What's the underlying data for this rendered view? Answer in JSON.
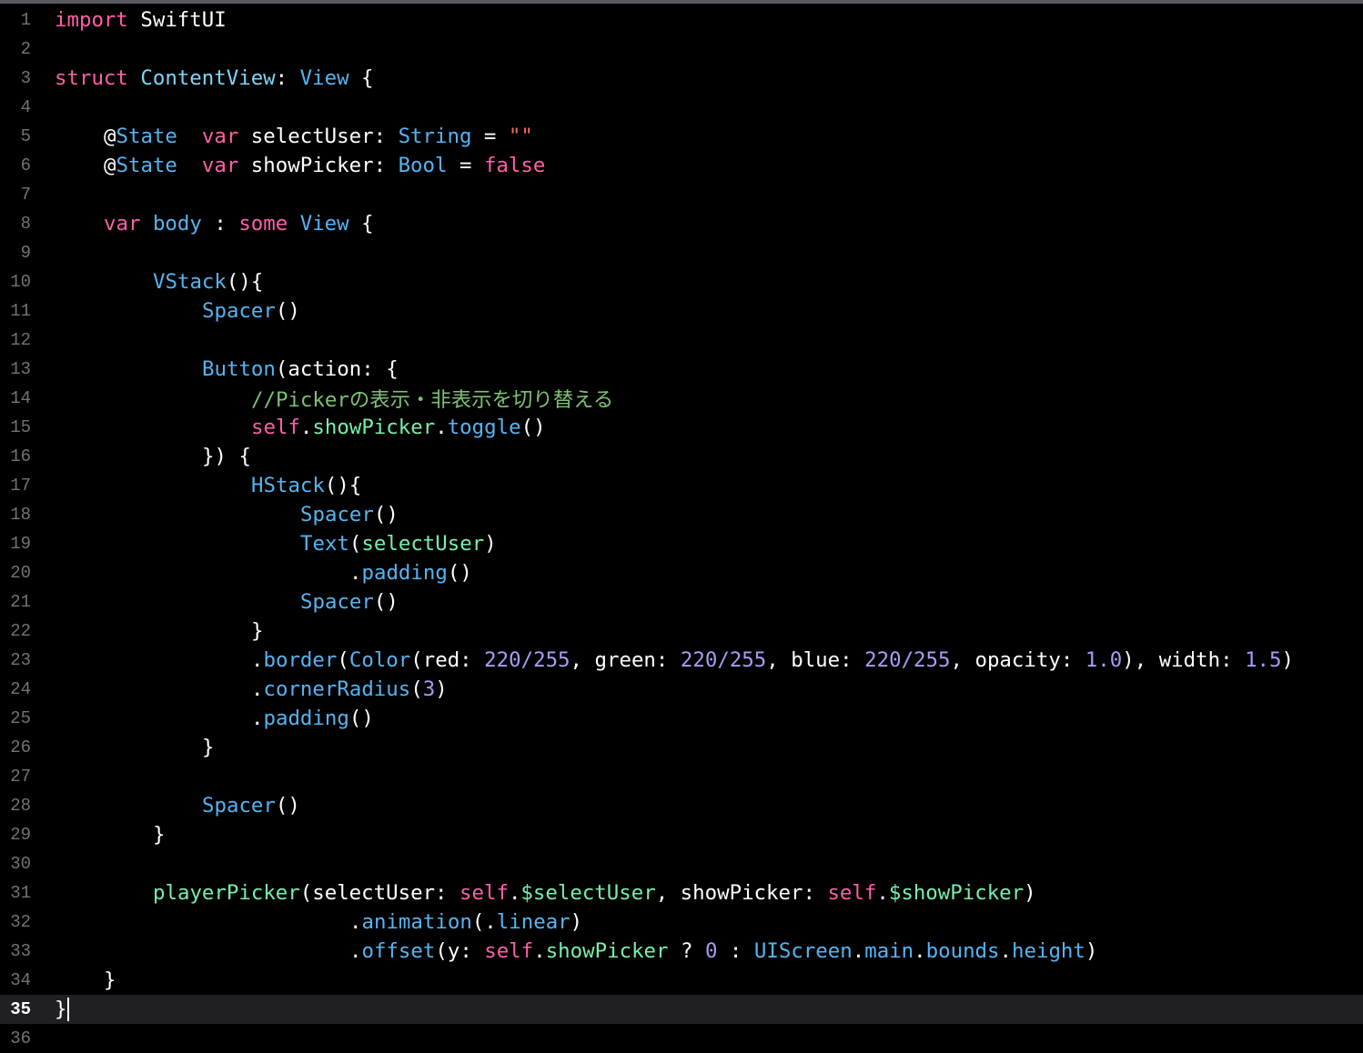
{
  "editor": {
    "current_line": 35,
    "colors": {
      "background": "#000000",
      "plain": "#ffffff",
      "keyword": "#fc5fa3",
      "type": "#5dd8ff",
      "project_type": "#67b7e4",
      "function": "#6bdfb8",
      "number": "#d0bf69",
      "number_alt": "#a167e6",
      "string": "#fc6a5d",
      "comment": "#7cc275",
      "line_number": "#737378"
    },
    "lines": [
      {
        "num": "1",
        "indent": 0,
        "tokens": [
          {
            "t": "import",
            "c": "keyword"
          },
          {
            "t": " SwiftUI",
            "c": "plain"
          }
        ]
      },
      {
        "num": "2",
        "indent": 0,
        "tokens": []
      },
      {
        "num": "3",
        "indent": 0,
        "tokens": [
          {
            "t": "struct",
            "c": "keyword"
          },
          {
            "t": " ",
            "c": "plain"
          },
          {
            "t": "ContentView",
            "c": "decl"
          },
          {
            "t": ": ",
            "c": "plain"
          },
          {
            "t": "View",
            "c": "type"
          },
          {
            "t": " {",
            "c": "plain"
          }
        ]
      },
      {
        "num": "4",
        "indent": 0,
        "tokens": []
      },
      {
        "num": "5",
        "indent": 4,
        "tokens": [
          {
            "t": "@",
            "c": "plain"
          },
          {
            "t": "State",
            "c": "type"
          },
          {
            "t": "  ",
            "c": "plain"
          },
          {
            "t": "var",
            "c": "keyword"
          },
          {
            "t": " selectUser: ",
            "c": "plain"
          },
          {
            "t": "String",
            "c": "type"
          },
          {
            "t": " = ",
            "c": "plain"
          },
          {
            "t": "\"\"",
            "c": "string"
          }
        ]
      },
      {
        "num": "6",
        "indent": 4,
        "tokens": [
          {
            "t": "@",
            "c": "plain"
          },
          {
            "t": "State",
            "c": "type"
          },
          {
            "t": "  ",
            "c": "plain"
          },
          {
            "t": "var",
            "c": "keyword"
          },
          {
            "t": " showPicker: ",
            "c": "plain"
          },
          {
            "t": "Bool",
            "c": "type"
          },
          {
            "t": " = ",
            "c": "plain"
          },
          {
            "t": "false",
            "c": "keyword"
          }
        ]
      },
      {
        "num": "7",
        "indent": 0,
        "tokens": []
      },
      {
        "num": "8",
        "indent": 4,
        "tokens": [
          {
            "t": "var",
            "c": "keyword"
          },
          {
            "t": " ",
            "c": "plain"
          },
          {
            "t": "body",
            "c": "type"
          },
          {
            "t": " : ",
            "c": "plain"
          },
          {
            "t": "some",
            "c": "keyword"
          },
          {
            "t": " ",
            "c": "plain"
          },
          {
            "t": "View",
            "c": "type"
          },
          {
            "t": " {",
            "c": "plain"
          }
        ]
      },
      {
        "num": "9",
        "indent": 0,
        "tokens": []
      },
      {
        "num": "10",
        "indent": 8,
        "tokens": [
          {
            "t": "VStack",
            "c": "type"
          },
          {
            "t": "(){",
            "c": "plain"
          }
        ]
      },
      {
        "num": "11",
        "indent": 12,
        "tokens": [
          {
            "t": "Spacer",
            "c": "type"
          },
          {
            "t": "()",
            "c": "plain"
          }
        ]
      },
      {
        "num": "12",
        "indent": 0,
        "tokens": []
      },
      {
        "num": "13",
        "indent": 12,
        "tokens": [
          {
            "t": "Button",
            "c": "type"
          },
          {
            "t": "(action: {",
            "c": "plain"
          }
        ]
      },
      {
        "num": "14",
        "indent": 16,
        "tokens": [
          {
            "t": "//Pickerの表示・非表示を切り替える",
            "c": "comment"
          }
        ]
      },
      {
        "num": "15",
        "indent": 16,
        "tokens": [
          {
            "t": "self",
            "c": "keyword"
          },
          {
            "t": ".",
            "c": "plain"
          },
          {
            "t": "showPicker",
            "c": "func"
          },
          {
            "t": ".",
            "c": "plain"
          },
          {
            "t": "toggle",
            "c": "type"
          },
          {
            "t": "()",
            "c": "plain"
          }
        ]
      },
      {
        "num": "16",
        "indent": 12,
        "tokens": [
          {
            "t": "}) {",
            "c": "plain"
          }
        ]
      },
      {
        "num": "17",
        "indent": 16,
        "tokens": [
          {
            "t": "HStack",
            "c": "type"
          },
          {
            "t": "(){",
            "c": "plain"
          }
        ]
      },
      {
        "num": "18",
        "indent": 20,
        "tokens": [
          {
            "t": "Spacer",
            "c": "type"
          },
          {
            "t": "()",
            "c": "plain"
          }
        ]
      },
      {
        "num": "19",
        "indent": 20,
        "tokens": [
          {
            "t": "Text",
            "c": "type"
          },
          {
            "t": "(",
            "c": "plain"
          },
          {
            "t": "selectUser",
            "c": "func"
          },
          {
            "t": ")",
            "c": "plain"
          }
        ]
      },
      {
        "num": "20",
        "indent": 24,
        "tokens": [
          {
            "t": ".",
            "c": "plain"
          },
          {
            "t": "padding",
            "c": "type"
          },
          {
            "t": "()",
            "c": "plain"
          }
        ]
      },
      {
        "num": "21",
        "indent": 20,
        "tokens": [
          {
            "t": "Spacer",
            "c": "type"
          },
          {
            "t": "()",
            "c": "plain"
          }
        ]
      },
      {
        "num": "22",
        "indent": 16,
        "tokens": [
          {
            "t": "}",
            "c": "plain"
          }
        ]
      },
      {
        "num": "23",
        "indent": 16,
        "tokens": [
          {
            "t": ".",
            "c": "plain"
          },
          {
            "t": "border",
            "c": "type"
          },
          {
            "t": "(",
            "c": "plain"
          },
          {
            "t": "Color",
            "c": "type"
          },
          {
            "t": "(red: ",
            "c": "plain"
          },
          {
            "t": "220",
            "c": "number"
          },
          {
            "t": "/",
            "c": "number"
          },
          {
            "t": "255",
            "c": "number"
          },
          {
            "t": ", green: ",
            "c": "plain"
          },
          {
            "t": "220",
            "c": "number"
          },
          {
            "t": "/",
            "c": "number"
          },
          {
            "t": "255",
            "c": "number"
          },
          {
            "t": ", blue: ",
            "c": "plain"
          },
          {
            "t": "220",
            "c": "number"
          },
          {
            "t": "/",
            "c": "number"
          },
          {
            "t": "255",
            "c": "number"
          },
          {
            "t": ", opacity: ",
            "c": "plain"
          },
          {
            "t": "1.0",
            "c": "number"
          },
          {
            "t": "), width: ",
            "c": "plain"
          },
          {
            "t": "1.5",
            "c": "number"
          },
          {
            "t": ")",
            "c": "plain"
          }
        ]
      },
      {
        "num": "24",
        "indent": 16,
        "tokens": [
          {
            "t": ".",
            "c": "plain"
          },
          {
            "t": "cornerRadius",
            "c": "type"
          },
          {
            "t": "(",
            "c": "plain"
          },
          {
            "t": "3",
            "c": "number"
          },
          {
            "t": ")",
            "c": "plain"
          }
        ]
      },
      {
        "num": "25",
        "indent": 16,
        "tokens": [
          {
            "t": ".",
            "c": "plain"
          },
          {
            "t": "padding",
            "c": "type"
          },
          {
            "t": "()",
            "c": "plain"
          }
        ]
      },
      {
        "num": "26",
        "indent": 12,
        "tokens": [
          {
            "t": "}",
            "c": "plain"
          }
        ]
      },
      {
        "num": "27",
        "indent": 0,
        "tokens": []
      },
      {
        "num": "28",
        "indent": 12,
        "tokens": [
          {
            "t": "Spacer",
            "c": "type"
          },
          {
            "t": "()",
            "c": "plain"
          }
        ]
      },
      {
        "num": "29",
        "indent": 8,
        "tokens": [
          {
            "t": "}",
            "c": "plain"
          }
        ]
      },
      {
        "num": "30",
        "indent": 0,
        "tokens": []
      },
      {
        "num": "31",
        "indent": 8,
        "tokens": [
          {
            "t": "playerPicker",
            "c": "func"
          },
          {
            "t": "(selectUser: ",
            "c": "plain"
          },
          {
            "t": "self",
            "c": "keyword"
          },
          {
            "t": ".",
            "c": "plain"
          },
          {
            "t": "$selectUser",
            "c": "func"
          },
          {
            "t": ", showPicker: ",
            "c": "plain"
          },
          {
            "t": "self",
            "c": "keyword"
          },
          {
            "t": ".",
            "c": "plain"
          },
          {
            "t": "$showPicker",
            "c": "func"
          },
          {
            "t": ")",
            "c": "plain"
          }
        ]
      },
      {
        "num": "32",
        "indent": 24,
        "tokens": [
          {
            "t": ".",
            "c": "plain"
          },
          {
            "t": "animation",
            "c": "type"
          },
          {
            "t": "(.",
            "c": "plain"
          },
          {
            "t": "linear",
            "c": "type"
          },
          {
            "t": ")",
            "c": "plain"
          }
        ]
      },
      {
        "num": "33",
        "indent": 24,
        "tokens": [
          {
            "t": ".",
            "c": "plain"
          },
          {
            "t": "offset",
            "c": "type"
          },
          {
            "t": "(y: ",
            "c": "plain"
          },
          {
            "t": "self",
            "c": "keyword"
          },
          {
            "t": ".",
            "c": "plain"
          },
          {
            "t": "showPicker",
            "c": "func"
          },
          {
            "t": " ? ",
            "c": "plain"
          },
          {
            "t": "0",
            "c": "number"
          },
          {
            "t": " : ",
            "c": "plain"
          },
          {
            "t": "UIScreen",
            "c": "type"
          },
          {
            "t": ".",
            "c": "plain"
          },
          {
            "t": "main",
            "c": "type"
          },
          {
            "t": ".",
            "c": "plain"
          },
          {
            "t": "bounds",
            "c": "type"
          },
          {
            "t": ".",
            "c": "plain"
          },
          {
            "t": "height",
            "c": "type"
          },
          {
            "t": ")",
            "c": "plain"
          }
        ]
      },
      {
        "num": "34",
        "indent": 4,
        "tokens": [
          {
            "t": "}",
            "c": "plain"
          }
        ]
      },
      {
        "num": "35",
        "indent": 0,
        "tokens": [
          {
            "t": "}",
            "c": "plain"
          }
        ]
      },
      {
        "num": "36",
        "indent": 0,
        "tokens": []
      }
    ]
  }
}
